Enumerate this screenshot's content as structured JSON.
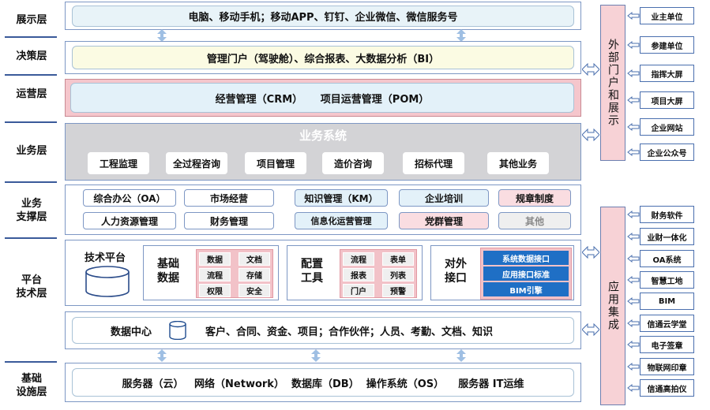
{
  "layers": {
    "presentation": "展示层",
    "decision": "决策层",
    "operation": "运营层",
    "business": "业务层",
    "support": "业务\n支撑层",
    "platform": "平台\n技术层",
    "infra": "基础\n设施层"
  },
  "presentation": {
    "text": "电脑、移动手机；移动APP、钉钉、企业微信、微信服务号"
  },
  "decision": {
    "text": "管理门户（驾驶舱）、综合报表、大数据分析（BI）"
  },
  "operation": {
    "text": "经营管理（CRM）     项目运营管理（POM）"
  },
  "business": {
    "title": "业务系统",
    "items": [
      "工程监理",
      "全过程咨询",
      "项目管理",
      "造价咨询",
      "招标代理",
      "其他业务"
    ]
  },
  "support": {
    "row1": [
      "综合办公（OA）",
      "市场经营",
      "知识管理（KM）",
      "企业培训",
      "规章制度"
    ],
    "row2": [
      "人力资源管理",
      "财务管理",
      "信息化运营管理",
      "党群管理",
      "其他"
    ]
  },
  "platform": {
    "tech_platform": "技术平台",
    "base_data": {
      "title": "基础\n数据",
      "cells": [
        "数据",
        "文档",
        "流程",
        "存储",
        "权限",
        "安全"
      ]
    },
    "config_tools": {
      "title": "配置\n工具",
      "cells": [
        "流程",
        "表单",
        "报表",
        "列表",
        "门户",
        "预警"
      ]
    },
    "external": {
      "title": "对外\n接口",
      "items": [
        "系统数据接口",
        "应用接口标准",
        "BIM引擎"
      ]
    }
  },
  "data_center": {
    "title": "数据中心",
    "text": "客户、合同、资金、项目；合作伙伴；人员、考勤、文档、知识"
  },
  "infra": {
    "text": "服务器（云）   网络（Network）  数据库（DB）  操作系统（OS）    服务器 IT运维"
  },
  "portal": {
    "title": "外部门户和展示",
    "items": [
      "业主单位",
      "参建单位",
      "指挥大屏",
      "项目大屏",
      "企业网站",
      "企业公众号"
    ]
  },
  "integration": {
    "title": "应用集成",
    "items": [
      "财务软件",
      "业财一体化",
      "OA系统",
      "智慧工地",
      "BIM",
      "信通云学堂",
      "电子签章",
      "物联网印章",
      "信通高拍仪"
    ]
  },
  "colors": {
    "presentation_bg": "#e8f3f8",
    "decision_bg": "#fbfbe3",
    "operation_frame": "#f5c6cc",
    "business_bg": "#d3d3d6",
    "support_pink": "#fadde1",
    "support_blue": "#e3f1f9",
    "external_blue": "#1f6fc5",
    "side_pink": "#f7d2d6"
  }
}
